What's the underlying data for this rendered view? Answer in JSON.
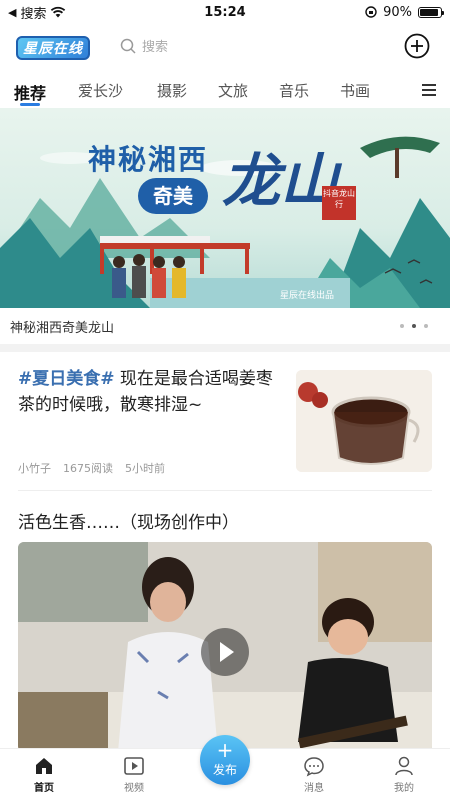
{
  "status_bar": {
    "carrier": "搜索",
    "time": "15:24",
    "battery": "90%",
    "battery_level": 0.9
  },
  "header": {
    "logo_text": "星辰在线",
    "search_placeholder": "搜索",
    "add_icon": "plus-circle-icon"
  },
  "tabs": {
    "items": [
      "推荐",
      "爱长沙",
      "摄影",
      "文旅",
      "音乐",
      "书画"
    ],
    "active_index": 0,
    "menu_icon": "menu-icon",
    "accent_color": "#2a7de1"
  },
  "banner": {
    "title_line1": "神秘湘西",
    "title_line2": "奇美",
    "title_big": "龙山",
    "seal_text": "抖音龙山行",
    "credit": "星辰在线出品",
    "caption": "神秘湘西奇美龙山",
    "dots_count": 3,
    "active_dot": 1
  },
  "article1": {
    "tag": "#夏日美食#",
    "title": " 现在是最合适喝姜枣茶的时候哦，散寒排湿~",
    "author": "小竹子",
    "reads": "1675阅读",
    "time": "5小时前"
  },
  "article2": {
    "title": "活色生香……（现场创作中）"
  },
  "bottom_nav": {
    "items": [
      {
        "label": "首页",
        "icon": "home-icon"
      },
      {
        "label": "视频",
        "icon": "video-icon"
      },
      {
        "label": "发布",
        "icon": "plus-icon"
      },
      {
        "label": "消息",
        "icon": "message-icon"
      },
      {
        "label": "我的",
        "icon": "user-icon"
      }
    ],
    "active_index": 0
  }
}
